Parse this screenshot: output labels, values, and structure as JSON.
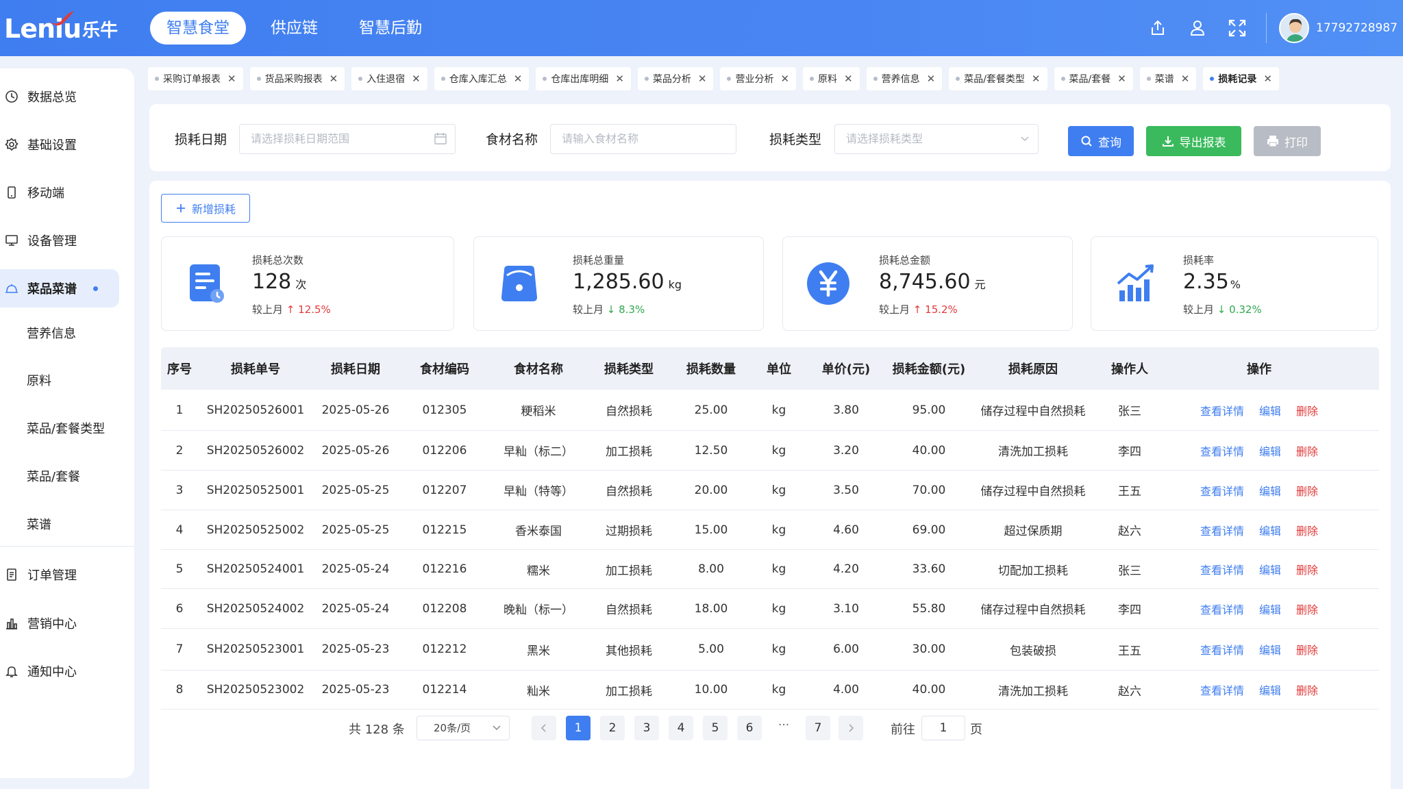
{
  "app": {
    "logo_text": "Leniu",
    "logo_cn": "乐牛",
    "phone": "17792728987",
    "top_nav": [
      {
        "label": "智慧食堂",
        "active": true
      },
      {
        "label": "供应链",
        "active": false
      },
      {
        "label": "智慧后勤",
        "active": false
      }
    ],
    "header_icons": [
      "share-icon",
      "user-icon",
      "fullscreen-icon"
    ]
  },
  "sidebar": {
    "items": [
      {
        "label": "数据总览",
        "icon": "clock-icon"
      },
      {
        "label": "基础设置",
        "icon": "gear-icon"
      },
      {
        "label": "移动端",
        "icon": "mobile-icon"
      },
      {
        "label": "设备管理",
        "icon": "monitor-icon"
      },
      {
        "label": "菜品菜谱",
        "icon": "cloche-icon",
        "active": true
      },
      {
        "label": "订单管理",
        "icon": "order-icon"
      },
      {
        "label": "营销中心",
        "icon": "bar-chart-icon"
      },
      {
        "label": "通知中心",
        "icon": "bell-icon"
      }
    ],
    "sub_items": [
      "营养信息",
      "原料",
      "菜品/套餐类型",
      "菜品/套餐",
      "菜谱"
    ]
  },
  "tabs": [
    {
      "label": "采购订单报表"
    },
    {
      "label": "货品采购报表"
    },
    {
      "label": "入住退宿"
    },
    {
      "label": "仓库入库汇总"
    },
    {
      "label": "仓库出库明细"
    },
    {
      "label": "菜品分析"
    },
    {
      "label": "营业分析"
    },
    {
      "label": "原料"
    },
    {
      "label": "营养信息"
    },
    {
      "label": "菜品/套餐类型"
    },
    {
      "label": "菜品/套餐"
    },
    {
      "label": "菜谱"
    },
    {
      "label": "损耗记录",
      "active": true
    }
  ],
  "filter": {
    "date_label": "损耗日期",
    "date_placeholder": "请选择损耗日期范围",
    "name_label": "食材名称",
    "name_placeholder": "请输入食材名称",
    "type_label": "损耗类型",
    "type_placeholder": "请选择损耗类型",
    "query_label": "查询",
    "export_label": "导出报表",
    "print_label": "打印"
  },
  "add_button": "新增损耗",
  "stats": [
    {
      "label": "损耗总次数",
      "value": "128",
      "unit": "次",
      "cmp_label": "较上月",
      "cmp_arrow": "↑",
      "cmp_value": "12.5%",
      "trend": "up",
      "icon": "document-icon"
    },
    {
      "label": "损耗总重量",
      "value": "1,285.60",
      "unit": "kg",
      "cmp_label": "较上月",
      "cmp_arrow": "↓",
      "cmp_value": "8.3%",
      "trend": "down",
      "icon": "scale-icon"
    },
    {
      "label": "损耗总金额",
      "value": "8,745.60",
      "unit": "元",
      "cmp_label": "较上月",
      "cmp_arrow": "↑",
      "cmp_value": "15.2%",
      "trend": "up",
      "icon": "yuan-icon"
    },
    {
      "label": "损耗率",
      "value": "2.35",
      "unit": "%",
      "cmp_label": "较上月",
      "cmp_arrow": "↓",
      "cmp_value": "0.32%",
      "trend": "down",
      "icon": "trend-chart-icon"
    }
  ],
  "table": {
    "headers": [
      "序号",
      "损耗单号",
      "损耗日期",
      "食材编码",
      "食材名称",
      "损耗类型",
      "损耗数量",
      "单位",
      "单价(元)",
      "损耗金额(元)",
      "损耗原因",
      "操作人",
      "操作"
    ],
    "actions": {
      "view": "查看详情",
      "edit": "编辑",
      "delete": "删除"
    },
    "rows": [
      [
        "1",
        "SH20250526001",
        "2025-05-26",
        "012305",
        "粳稻米",
        "自然损耗",
        "25.00",
        "kg",
        "3.80",
        "95.00",
        "储存过程中自然损耗",
        "张三"
      ],
      [
        "2",
        "SH20250526002",
        "2025-05-26",
        "012206",
        "早籼（标二）",
        "加工损耗",
        "12.50",
        "kg",
        "3.20",
        "40.00",
        "清洗加工损耗",
        "李四"
      ],
      [
        "3",
        "SH20250525001",
        "2025-05-25",
        "012207",
        "早籼（特等）",
        "自然损耗",
        "20.00",
        "kg",
        "3.50",
        "70.00",
        "储存过程中自然损耗",
        "王五"
      ],
      [
        "4",
        "SH20250525002",
        "2025-05-25",
        "012215",
        "香米泰国",
        "过期损耗",
        "15.00",
        "kg",
        "4.60",
        "69.00",
        "超过保质期",
        "赵六"
      ],
      [
        "5",
        "SH20250524001",
        "2025-05-24",
        "012216",
        "糯米",
        "加工损耗",
        "8.00",
        "kg",
        "4.20",
        "33.60",
        "切配加工损耗",
        "张三"
      ],
      [
        "6",
        "SH20250524002",
        "2025-05-24",
        "012208",
        "晚籼（标一）",
        "自然损耗",
        "18.00",
        "kg",
        "3.10",
        "55.80",
        "储存过程中自然损耗",
        "李四"
      ],
      [
        "7",
        "SH20250523001",
        "2025-05-23",
        "012212",
        "黑米",
        "其他损耗",
        "5.00",
        "kg",
        "6.00",
        "30.00",
        "包装破损",
        "王五"
      ],
      [
        "8",
        "SH20250523002",
        "2025-05-23",
        "012214",
        "籼米",
        "加工损耗",
        "10.00",
        "kg",
        "4.00",
        "40.00",
        "清洗加工损耗",
        "赵六"
      ]
    ]
  },
  "pagination": {
    "total": "共 128 条",
    "page_size": "20条/页",
    "pages": [
      "1",
      "2",
      "3",
      "4",
      "5",
      "6",
      "7"
    ],
    "current": "1",
    "ellipsis": "···",
    "goto_label": "前往",
    "goto_value": "1",
    "page_suffix": "页"
  },
  "colors": {
    "primary": "#3f7ef0",
    "success": "#3aba5c",
    "danger": "#e33a3a",
    "disabled": "#b8bcc4"
  }
}
